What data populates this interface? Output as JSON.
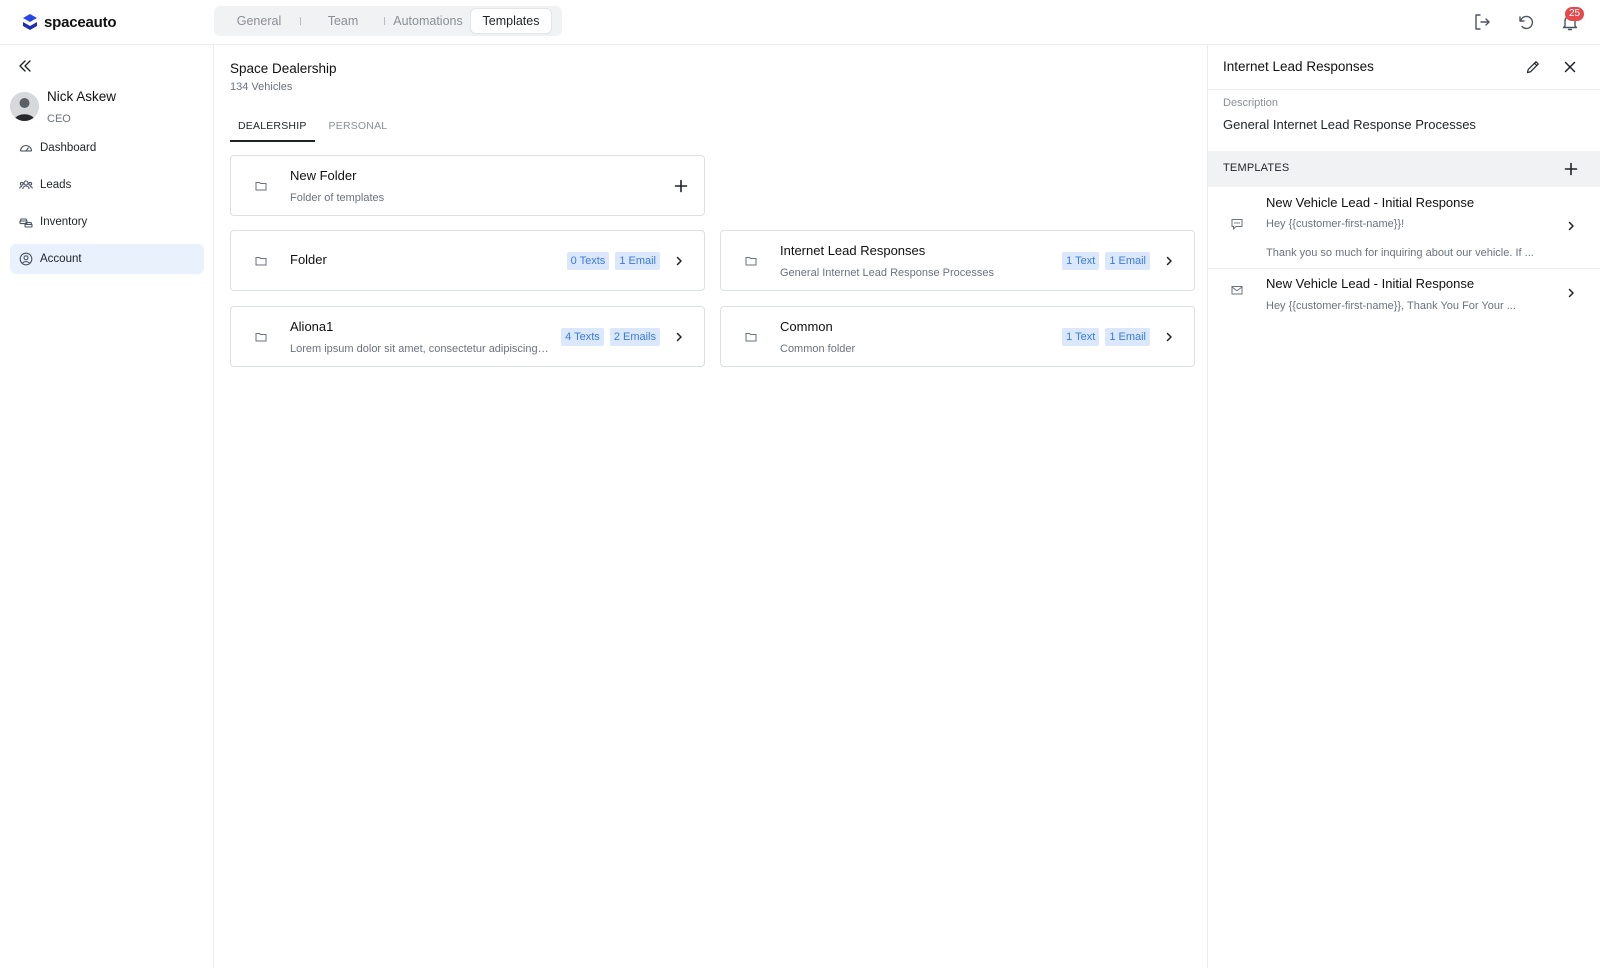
{
  "app": {
    "logo_text": "spaceauto",
    "brand_color": "#2b46e6"
  },
  "nav_tabs": [
    {
      "label": "General",
      "active": false
    },
    {
      "label": "Team",
      "active": false
    },
    {
      "label": "Automations",
      "active": false
    },
    {
      "label": "Templates",
      "active": true
    }
  ],
  "topbar": {
    "icons": [
      "logout-icon",
      "refresh-icon",
      "bell-icon"
    ],
    "notification_count": "25"
  },
  "sidebar": {
    "user": {
      "name": "Nick Askew",
      "role": "CEO"
    },
    "items": [
      {
        "label": "Dashboard",
        "icon": "dashboard-icon",
        "active": false
      },
      {
        "label": "Leads",
        "icon": "users-icon",
        "active": false
      },
      {
        "label": "Inventory",
        "icon": "cars-icon",
        "active": false
      },
      {
        "label": "Account",
        "icon": "account-icon",
        "active": true
      }
    ]
  },
  "main": {
    "dealership": "Space Dealership",
    "vehicles": "134 Vehicles",
    "tabs": [
      {
        "label": "DEALERSHIP",
        "active": true
      },
      {
        "label": "PERSONAL",
        "active": false
      }
    ],
    "new_folder": {
      "title": "New Folder",
      "subtitle": "Folder of templates"
    },
    "folders": [
      {
        "title": "Folder",
        "subtitle": "",
        "texts": "0 Texts",
        "emails": "1 Email"
      },
      {
        "title": "Internet Lead Responses",
        "subtitle": "General Internet Lead Response Processes",
        "texts": "1 Text",
        "emails": "1 Email"
      },
      {
        "title": "Aliona1",
        "subtitle": "Lorem ipsum dolor sit amet, consectetur adipiscing elit",
        "texts": "4 Texts",
        "emails": "2 Emails"
      },
      {
        "title": "Common",
        "subtitle": "Common folder",
        "texts": "1 Text",
        "emails": "1 Email"
      }
    ]
  },
  "panel": {
    "title": "Internet Lead Responses",
    "description_label": "Description",
    "description": "General Internet Lead Response Processes",
    "templates_label": "TEMPLATES",
    "templates": [
      {
        "type": "sms",
        "icon": "message-icon",
        "title": "New Vehicle Lead - Initial Response",
        "line1": "Hey {{customer-first-name}}!",
        "line2": "Thank you so much for inquiring about our vehicle. If ..."
      },
      {
        "type": "email",
        "icon": "mail-icon",
        "title": "New Vehicle Lead - Initial Response",
        "line1": "Hey {{customer-first-name}}, Thank You For Your ..."
      }
    ]
  }
}
